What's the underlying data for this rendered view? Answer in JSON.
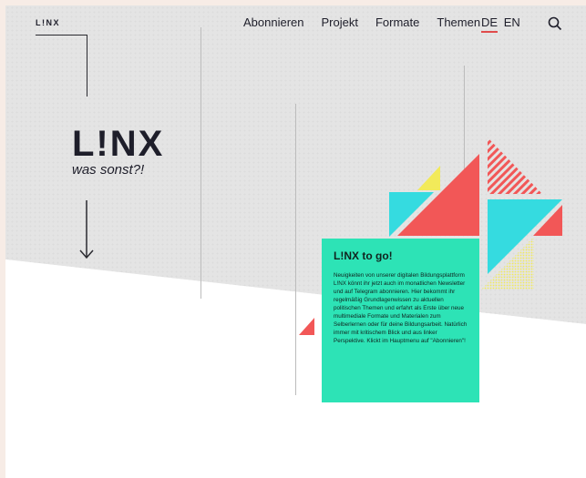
{
  "header": {
    "logo": "L!NX",
    "nav": [
      "Abonnieren",
      "Projekt",
      "Formate",
      "Themen"
    ],
    "languages": [
      "DE",
      "EN"
    ],
    "active_language": "DE"
  },
  "hero": {
    "logo": "L!NX",
    "tagline": "was sonst?!"
  },
  "card": {
    "title": "L!NX to go!",
    "text": "Neuigkeiten von unserer digitalen Bildungsplattform L!NX könnt ihr jetzt auch im monatlichen Newsletter und auf Telegram abonnieren. Hier bekommt ihr regelmäßig Grundlagenwissen zu aktuellen politischen Themen und erfahrt als Erste über neue multimediale Formate und Materialen zum Selberlernen oder für deine Bildungsarbeit. Natürlich immer mit kritischem Blick und aus linker Perspektive. Klickt im Hauptmenu auf \"Abonnieren\"!"
  },
  "colors": {
    "accent_red": "#f25757",
    "accent_turquoise": "#2de3b6",
    "accent_cyan": "#35dbe0",
    "accent_yellow": "#f2ea5a",
    "text_dark": "#1e1e2a"
  },
  "icons": {
    "search": "search-icon",
    "arrow": "arrow-down-icon"
  }
}
